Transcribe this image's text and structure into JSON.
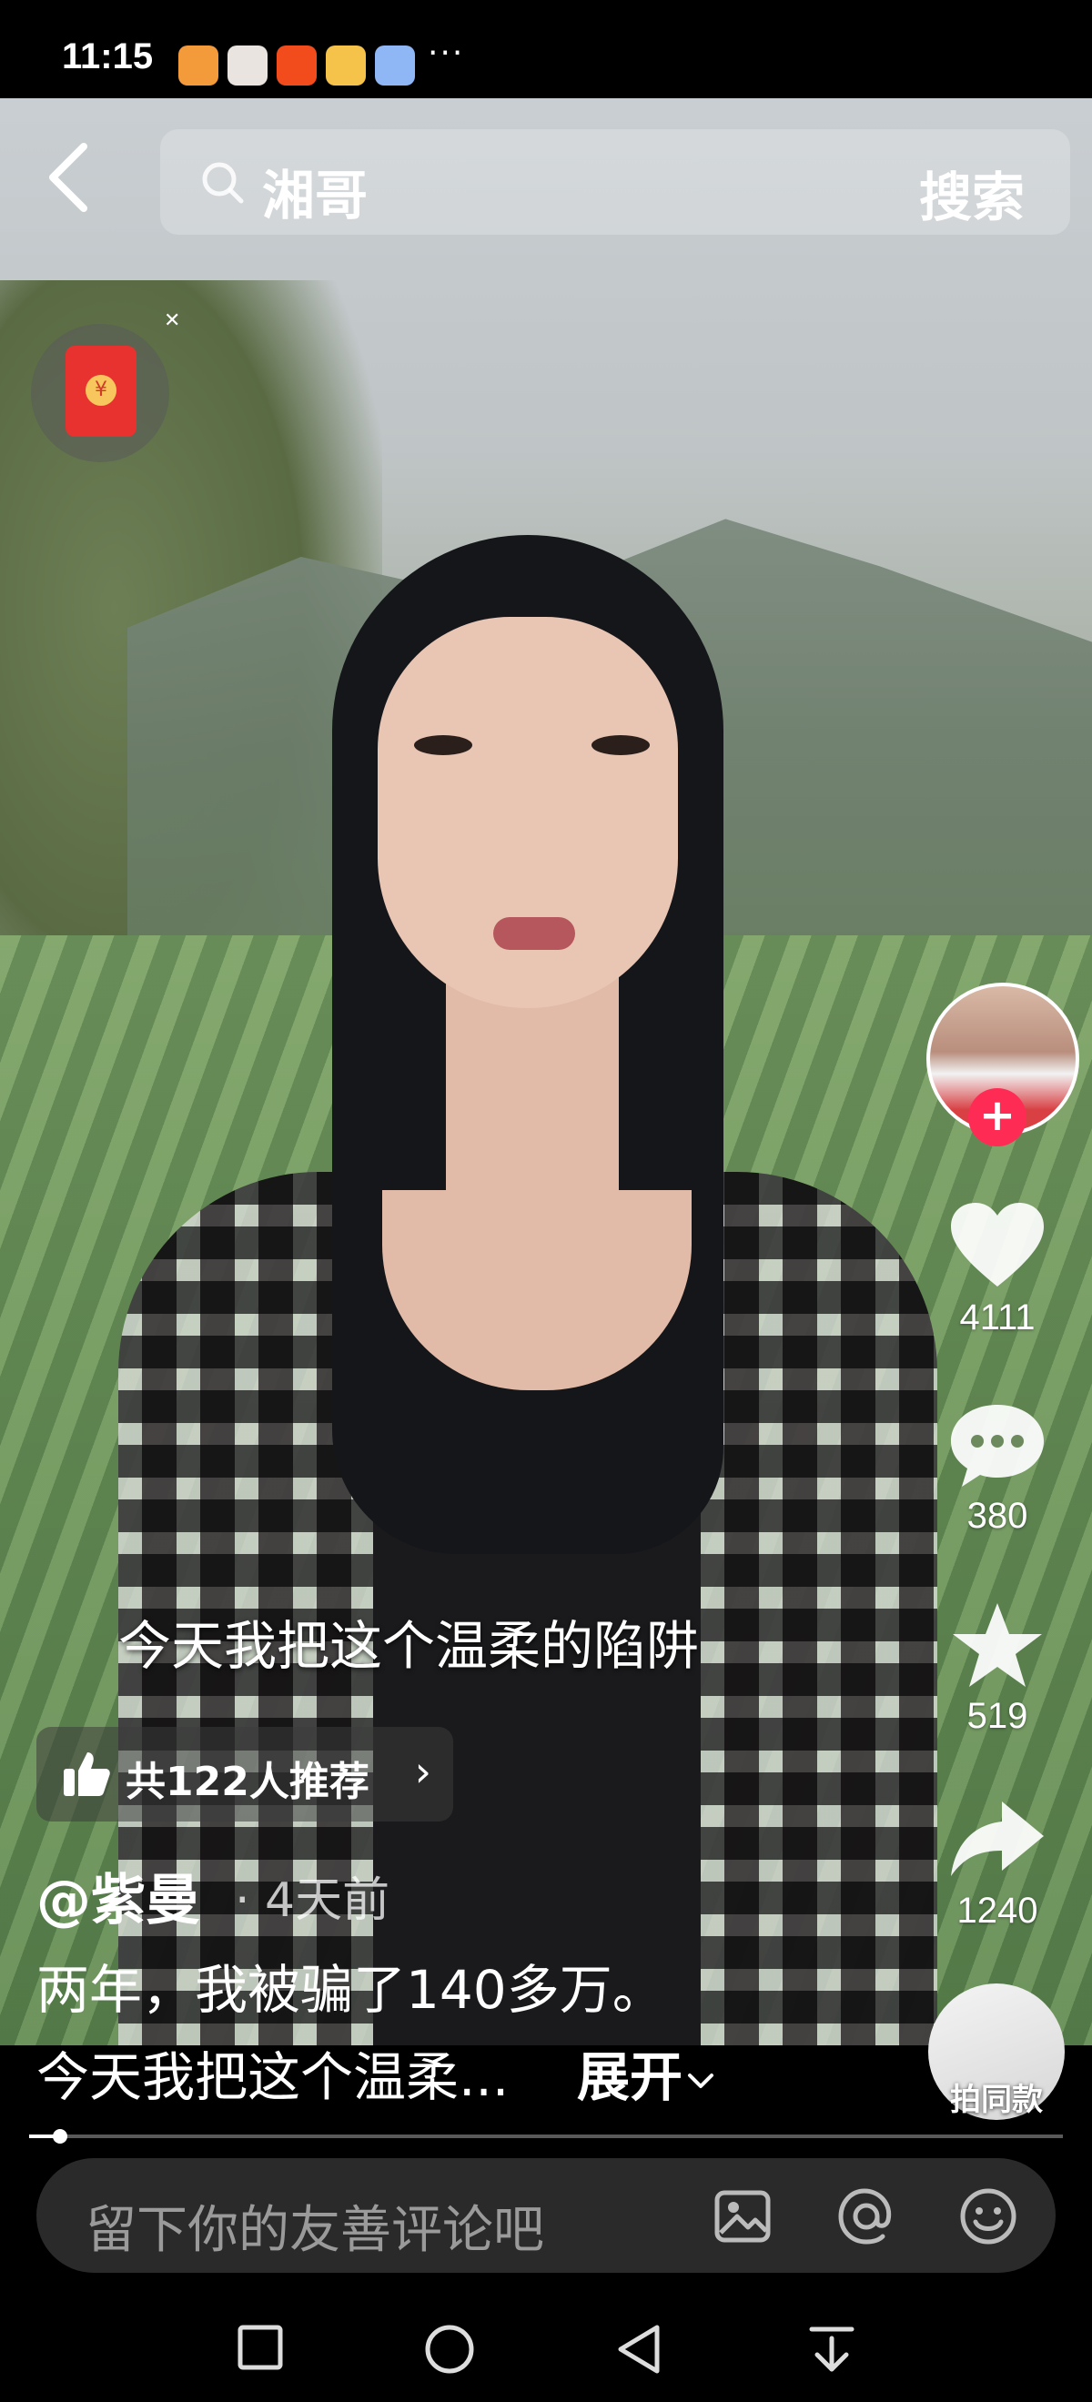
{
  "status_bar": {
    "time": "11:15",
    "more": "···"
  },
  "search": {
    "query": "湘哥",
    "button_label": "搜索"
  },
  "overlay": {
    "subtitle": "今天我把这个温柔的陷阱"
  },
  "recommend": {
    "label": "共122人推荐",
    "chevron": "›"
  },
  "author": {
    "name": "@紫曼",
    "time_ago": "· 4天前"
  },
  "description": {
    "line1": "两年，我被骗了140多万。",
    "line2": "今天我把这个温柔...",
    "expand_label": "展开"
  },
  "actions": {
    "likes": "4111",
    "comments": "380",
    "favorites": "519",
    "shares": "1240",
    "same_style_label": "拍同款"
  },
  "progress": {
    "played_fraction": 0.03
  },
  "comment_bar": {
    "placeholder": "留下你的友善评论吧"
  },
  "colors": {
    "follow": "#fe2c55",
    "red_packet": "#e8322f"
  }
}
